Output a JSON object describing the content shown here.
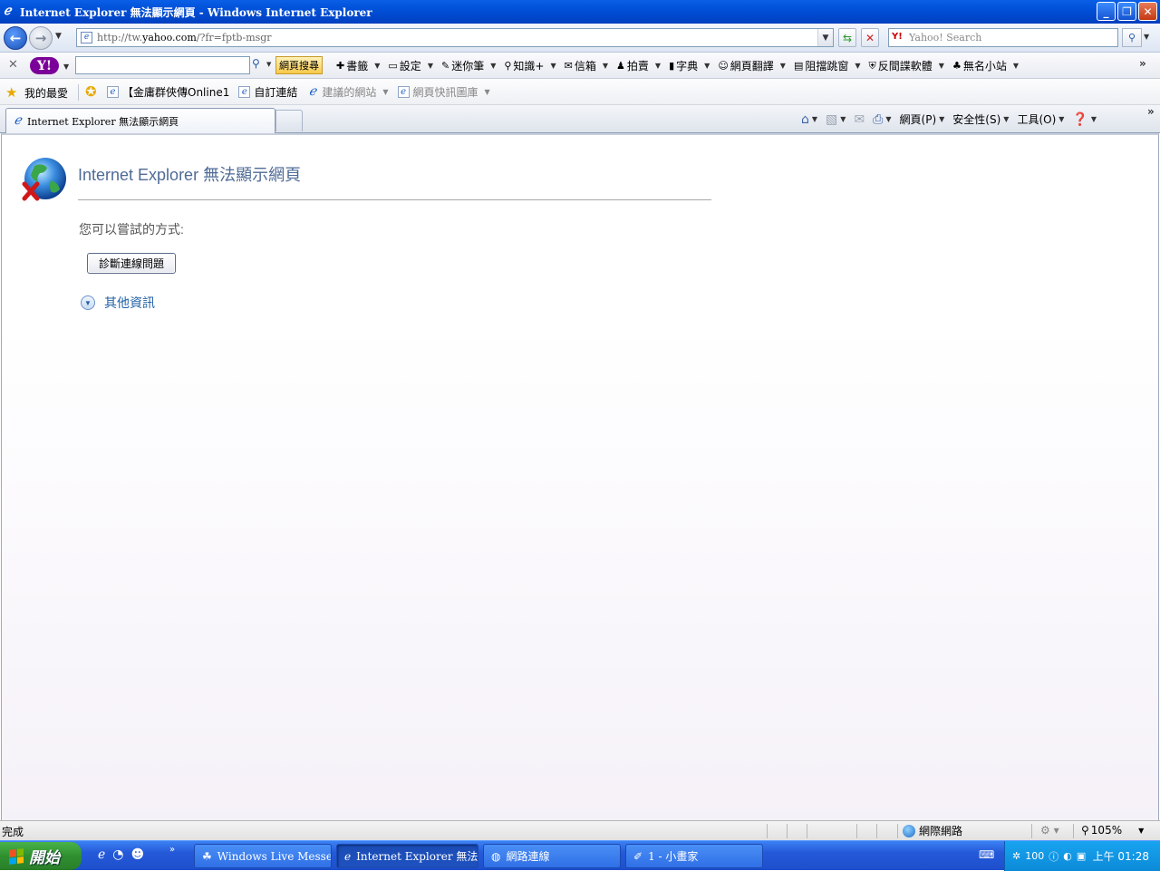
{
  "window": {
    "title": "Internet Explorer 無法顯示網頁 - Windows Internet Explorer",
    "minimize_icon": "minimize-icon",
    "maximize_icon": "restore-icon",
    "close_icon": "close-icon"
  },
  "nav": {
    "url_prefix": "http://tw.",
    "url_domain": "yahoo.com",
    "url_suffix": "/?fr=fptb-msgr",
    "search_placeholder": "Yahoo! Search",
    "search_logo": "Y!"
  },
  "yahoo_toolbar": {
    "logo": "Y!",
    "search_button": "網頁搜尋",
    "items": [
      {
        "label": "書籤",
        "icon": "bookmark-icon",
        "glyph": "✚"
      },
      {
        "label": "設定",
        "icon": "settings-icon",
        "glyph": "▭"
      },
      {
        "label": "迷你筆",
        "icon": "pen-icon",
        "glyph": "✎"
      },
      {
        "label": "知識+",
        "icon": "knowledge-icon",
        "glyph": "⚲"
      },
      {
        "label": "信箱",
        "icon": "mail-icon",
        "glyph": "✉"
      },
      {
        "label": "拍賣",
        "icon": "auction-icon",
        "glyph": "♟"
      },
      {
        "label": "字典",
        "icon": "dictionary-icon",
        "glyph": "▮"
      },
      {
        "label": "網頁翻譯",
        "icon": "translate-icon",
        "glyph": "☺"
      },
      {
        "label": "阻擋跳窗",
        "icon": "popup-blocker-icon",
        "glyph": "▤"
      },
      {
        "label": "反間諜軟體",
        "icon": "antispy-icon",
        "glyph": "⛨"
      },
      {
        "label": "無名小站",
        "icon": "wretch-icon",
        "glyph": "♣"
      }
    ]
  },
  "favorites": {
    "label": "我的最愛",
    "links": [
      {
        "label": "【金庸群俠傳Online1",
        "dim": false,
        "dropdown": false
      },
      {
        "label": "自訂連結",
        "dim": false,
        "dropdown": false
      },
      {
        "label": "建議的網站",
        "dim": true,
        "dropdown": true
      },
      {
        "label": "網頁快訊圖庫",
        "dim": true,
        "dropdown": true
      }
    ]
  },
  "tabs": {
    "active_tab": "Internet Explorer 無法顯示網頁"
  },
  "command_bar": {
    "page": "網頁(P)",
    "safety": "安全性(S)",
    "tools": "工具(O)",
    "help_icon": "help-icon"
  },
  "content": {
    "heading": "Internet Explorer 無法顯示網頁",
    "try_text": "您可以嘗試的方式:",
    "diagnose_button": "診斷連線問題",
    "more_info": "其他資訊"
  },
  "status": {
    "text": "完成",
    "zone": "網際網路",
    "zoom": "105%"
  },
  "taskbar": {
    "start": "開始",
    "buttons": [
      {
        "label": "Windows Live Messen...",
        "icon": "messenger-icon",
        "glyph": "☘",
        "active": false,
        "width": 152
      },
      {
        "label": "Internet Explorer 無法...",
        "icon": "ie-icon",
        "glyph": "ℯ",
        "active": true,
        "width": 157
      },
      {
        "label": "網路連線",
        "icon": "network-icon",
        "glyph": "◍",
        "active": false,
        "width": 152
      },
      {
        "label": "1 - 小畫家",
        "icon": "paint-icon",
        "glyph": "✐",
        "active": false,
        "width": 152
      }
    ],
    "clock": "上午 01:28",
    "tray_battery": "100"
  }
}
